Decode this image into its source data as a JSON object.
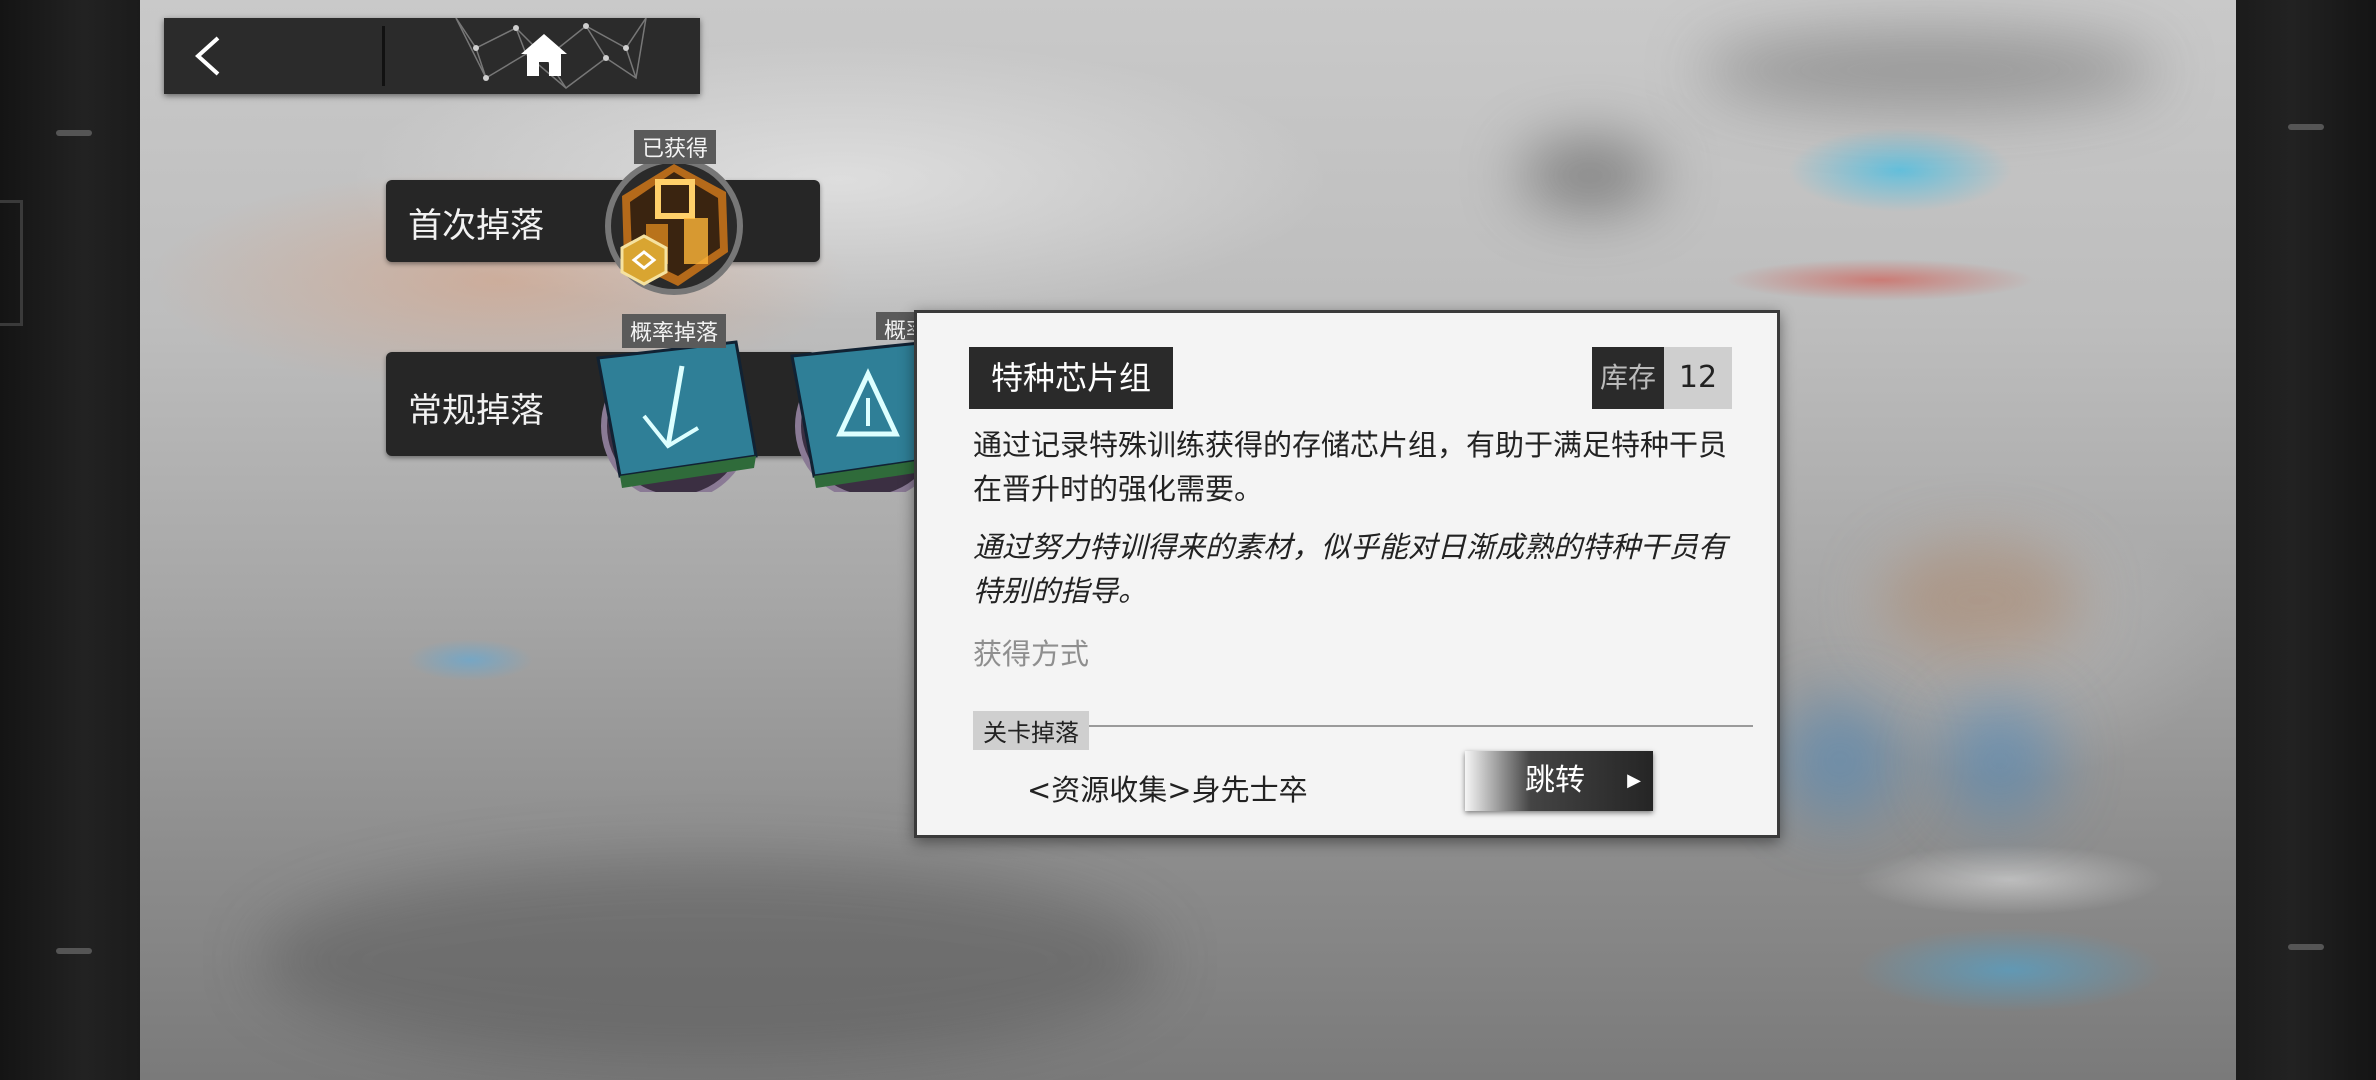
{
  "nav": {
    "back": "back",
    "home": "home"
  },
  "first_drop": {
    "label": "首次掉落",
    "item_tag": "已获得"
  },
  "normal_drop": {
    "label": "常规掉落",
    "items": [
      {
        "tag": "概率掉落"
      },
      {
        "tag": "概率掉落"
      }
    ]
  },
  "tooltip": {
    "title": "特种芯片组",
    "stock_label": "库存",
    "stock_count": "12",
    "description": "通过记录特殊训练获得的存储芯片组，有助于满足特种干员在晋升时的强化需要。",
    "flavor": "通过努力特训得来的素材，似乎能对日渐成熟的特种干员有特别的指导。",
    "obtain_label": "获得方式",
    "section_tag": "关卡掉落",
    "stage": "<资源收集>身先士卒",
    "jump_label": "跳转"
  },
  "colors": {
    "panel_bg": "#f4f4f4",
    "dark": "#2a2a2a",
    "gold": "#d9a531",
    "chip_blue": "#2f7f97"
  }
}
